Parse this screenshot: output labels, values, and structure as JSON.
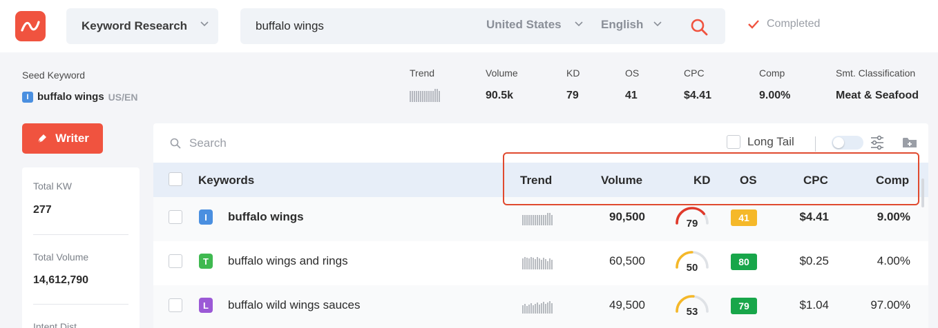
{
  "header": {
    "tool": "Keyword Research",
    "query": "buffalo wings",
    "country": "United States",
    "language": "English",
    "status": "Completed"
  },
  "seed": {
    "label": "Seed Keyword",
    "keyword": "buffalo wings",
    "intent": "I",
    "locale": "US/EN",
    "metrics": [
      {
        "label": "Trend",
        "value": ""
      },
      {
        "label": "Volume",
        "value": "90.5k"
      },
      {
        "label": "KD",
        "value": "79"
      },
      {
        "label": "OS",
        "value": "41"
      },
      {
        "label": "CPC",
        "value": "$4.41"
      },
      {
        "label": "Comp",
        "value": "9.00%"
      },
      {
        "label": "Smt. Classification",
        "value": "Meat & Seafood"
      }
    ]
  },
  "sidebar": {
    "writer": "Writer",
    "stats": [
      {
        "label": "Total KW",
        "value": "277"
      },
      {
        "label": "Total Volume",
        "value": "14,612,790"
      },
      {
        "label": "Intent Dist.",
        "value": ""
      }
    ]
  },
  "table": {
    "search_placeholder": "Search",
    "long_tail": "Long Tail",
    "columns": {
      "keywords": "Keywords",
      "trend": "Trend",
      "volume": "Volume",
      "kd": "KD",
      "os": "OS",
      "cpc": "CPC",
      "comp": "Comp"
    },
    "rows": [
      {
        "intent": "I",
        "intent_color": "#4a8fe0",
        "keyword": "buffalo wings",
        "volume": "90,500",
        "kd": "79",
        "kd_fraction": 0.79,
        "kd_color": "#e0392b",
        "os": "41",
        "os_color": "#f5b829",
        "cpc": "$4.41",
        "comp": "9.00%"
      },
      {
        "intent": "T",
        "intent_color": "#3fb950",
        "keyword": "buffalo wings and rings",
        "volume": "60,500",
        "kd": "50",
        "kd_fraction": 0.5,
        "kd_color": "#f5b829",
        "os": "80",
        "os_color": "#18a64a",
        "cpc": "$0.25",
        "comp": "4.00%"
      },
      {
        "intent": "L",
        "intent_color": "#9b59d6",
        "keyword": "buffalo wild wings sauces",
        "volume": "49,500",
        "kd": "53",
        "kd_fraction": 0.53,
        "kd_color": "#f5b829",
        "os": "79",
        "os_color": "#18a64a",
        "cpc": "$1.04",
        "comp": "97.00%"
      }
    ]
  },
  "colors": {
    "accent": "#f0533f",
    "highlight": "#e0492e",
    "header_bg": "#e7eef8"
  }
}
